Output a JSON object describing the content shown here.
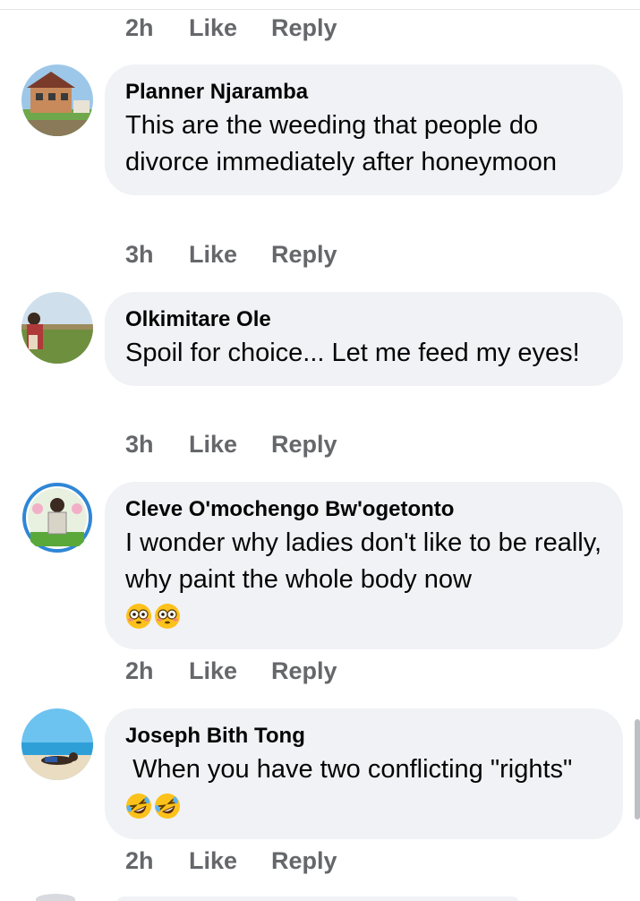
{
  "top_actions": {
    "time": "2h",
    "like": "Like",
    "reply": "Reply"
  },
  "comments": [
    {
      "author": "Planner Njaramba",
      "text": "This are the weeding that people do divorce immediately after honeymoon",
      "emojis": [],
      "time": "3h",
      "like": "Like",
      "reply": "Reply"
    },
    {
      "author": "Olkimitare Ole",
      "text": "Spoil for choice... Let me feed my eyes!",
      "emojis": [],
      "time": "3h",
      "like": "Like",
      "reply": "Reply"
    },
    {
      "author": "Cleve O'mochengo Bw'ogetonto",
      "text": "I wonder why ladies don't like to be really, why paint the whole body now",
      "emojis": [
        "flushed-face",
        "flushed-face"
      ],
      "time": "2h",
      "like": "Like",
      "reply": "Reply"
    },
    {
      "author": "Joseph Bith Tong",
      "text": " When you have two conflicting \"rights\"",
      "emojis": [
        "rolling-laughing-face",
        "rolling-laughing-face"
      ],
      "time": "2h",
      "like": "Like",
      "reply": "Reply"
    }
  ],
  "colors": {
    "bubble": "#f0f2f5",
    "meta_text": "#65676b",
    "body_text": "#050505",
    "emoji_yellow": "#fcc21b"
  }
}
